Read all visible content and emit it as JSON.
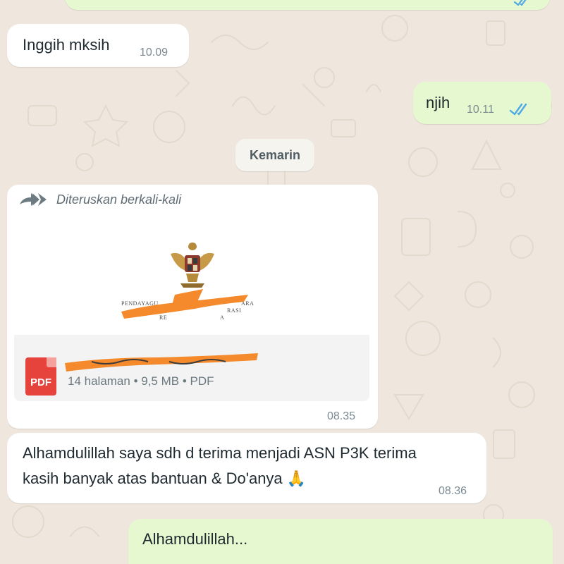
{
  "colors": {
    "wallpaper": "#efe7de",
    "incoming_bubble": "#ffffff",
    "outgoing_bubble": "#e5f8cf",
    "read_ticks": "#4fa9e6",
    "pdf_badge": "#e5433c"
  },
  "messages": {
    "m1": {
      "text": "Inggih mksih",
      "time": "10.09"
    },
    "m2": {
      "text": "njih",
      "time": "10.11",
      "status": "read"
    },
    "date_divider": "Kemarin",
    "m3": {
      "forwarded_label": "Diteruskan berkali-kali",
      "preview_lines": [
        "PENDAYAGU",
        "ARA",
        "RASI",
        "RE",
        "A"
      ],
      "file_type_badge": "PDF",
      "file_meta": "14 halaman • 9,5 MB • PDF",
      "time": "08.35"
    },
    "m4": {
      "line1": "Alhamdulillah saya sdh d terima menjadi ASN P3K terima",
      "line2": "kasih banyak atas bantuan & Do'anya 🙏",
      "time": "08.36"
    },
    "m5": {
      "text": "Alhamdulillah..."
    }
  },
  "icons": {
    "forward": "forward-arrows-icon",
    "ticks": "double-check-icon",
    "pdf": "pdf-file-icon",
    "emblem": "garuda-emblem"
  }
}
